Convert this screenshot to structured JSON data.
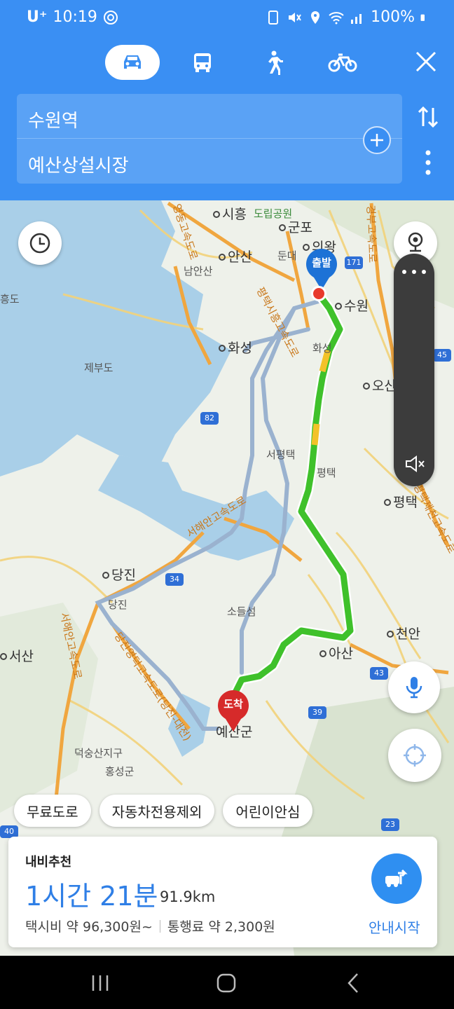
{
  "status_bar": {
    "carrier": "U⁺",
    "time": "10:19",
    "battery": "100%"
  },
  "transport_modes": [
    {
      "name": "car",
      "active": true
    },
    {
      "name": "bus",
      "active": false
    },
    {
      "name": "walk",
      "active": false
    },
    {
      "name": "bike",
      "active": false
    }
  ],
  "route_input": {
    "origin": "수원역",
    "destination": "예산상설시장"
  },
  "map": {
    "labels": {
      "siheung": "시흥",
      "dorip_park": "도립공원",
      "gunpo": "군포",
      "anyang": "안양",
      "uiwang": "의왕",
      "ansan": "안산",
      "dundae": "둔대",
      "namansan": "남안산",
      "suwon": "수원",
      "hwaseong": "화성",
      "hwaseong_jc": "화성",
      "jebudo": "제부도",
      "osan": "오산",
      "seopyeongtaek": "서평택",
      "pyeongtaek_jc": "평택",
      "pyeongtaek": "평택",
      "dangjin": "당진",
      "dangjin_jc": "당진",
      "sodeulseom": "소들섬",
      "cheonan": "천안",
      "asan": "아산",
      "seosan": "서산",
      "yesan": "예산군",
      "deoksungsan": "덕숭산지구",
      "hongseong": "홍성군",
      "heungdo": "흥도",
      "expressway_west_coast": "서해안고속도로",
      "expressway_pyeongtaek_siheung": "평택시흥고속도로",
      "expressway_dangjin_yeongdeok": "당진영덕고속도로(당진-대전)",
      "expressway_seoul_sejong": "서울세종고속도로",
      "expressway_gyeongbu": "경부고속도로",
      "expressway_yeongdong": "영동고속도로",
      "expressway_pyeongtaek_jecheon": "평택제천고속도로",
      "expressway_seohaean_2": "서해안고속도로"
    },
    "route_shields": [
      "171",
      "45",
      "82",
      "34",
      "43",
      "39",
      "23",
      "40"
    ],
    "pins": {
      "start": "출발",
      "end": "도착"
    }
  },
  "filters": [
    "무료도로",
    "자동차전용제외",
    "어린이안심"
  ],
  "route_card": {
    "tag": "내비추천",
    "duration": "1시간 21분",
    "distance": "91.9km",
    "taxi_fare": "택시비 약 96,300원~",
    "toll": "통행료 약 2,300원",
    "start_label": "안내시작"
  },
  "colors": {
    "header": "#3a8ff3",
    "route_main": "#3fc12b",
    "route_alt": "#9ab2cf",
    "accent": "#2f7fe6",
    "start_pin": "#1d72d6",
    "end_pin": "#d62a2a"
  }
}
